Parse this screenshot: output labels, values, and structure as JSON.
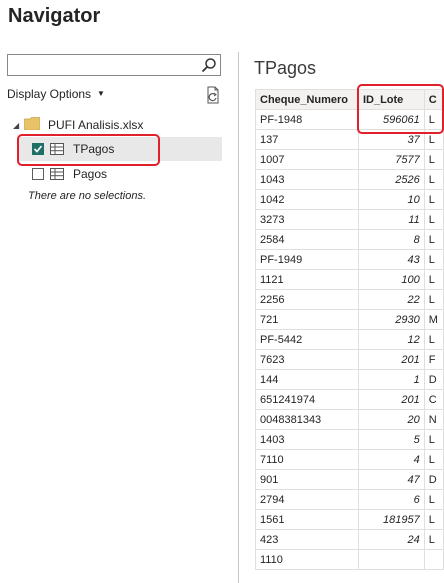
{
  "window": {
    "title": "Navigator"
  },
  "search": {
    "placeholder": ""
  },
  "options": {
    "display_options_label": "Display Options"
  },
  "tree": {
    "file_label": "PUFI Analisis.xlsx",
    "items": [
      {
        "label": "TPagos",
        "checked": true
      },
      {
        "label": "Pagos",
        "checked": false
      }
    ],
    "no_selection_text": "There are no selections."
  },
  "preview": {
    "title": "TPagos",
    "columns": [
      "Cheque_Numero",
      "ID_Lote",
      "C"
    ],
    "rows": [
      [
        "PF-1948",
        "596061",
        "L"
      ],
      [
        "137",
        "37",
        "L"
      ],
      [
        "1007",
        "7577",
        "L"
      ],
      [
        "1043",
        "2526",
        "L"
      ],
      [
        "1042",
        "10",
        "L"
      ],
      [
        "3273",
        "11",
        "L"
      ],
      [
        "2584",
        "8",
        "L"
      ],
      [
        "PF-1949",
        "43",
        "L"
      ],
      [
        "1121",
        "100",
        "L"
      ],
      [
        "2256",
        "22",
        "L"
      ],
      [
        "721",
        "2930",
        "M"
      ],
      [
        "PF-5442",
        "12",
        "L"
      ],
      [
        "7623",
        "201",
        "F"
      ],
      [
        "144",
        "1",
        "D"
      ],
      [
        "651241974",
        "201",
        "C"
      ],
      [
        "0048381343",
        "20",
        "N"
      ],
      [
        "1403",
        "5",
        "L"
      ],
      [
        "7110",
        "4",
        "L"
      ],
      [
        "901",
        "47",
        "D"
      ],
      [
        "2794",
        "6",
        "L"
      ],
      [
        "1561",
        "181957",
        "L"
      ],
      [
        "423",
        "24",
        "L"
      ],
      [
        "1110",
        "",
        ""
      ]
    ]
  },
  "colors": {
    "accent": "#1f6f66",
    "highlight": "#e0202a"
  }
}
